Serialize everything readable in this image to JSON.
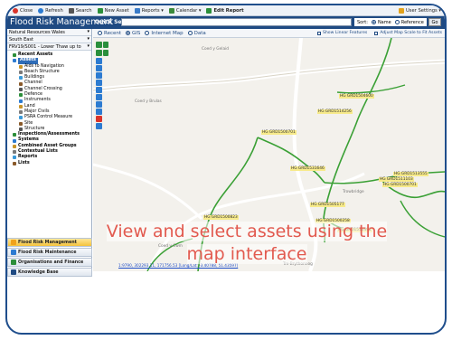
{
  "toolbar": {
    "items": [
      {
        "label": "Close",
        "icon": "close-icon",
        "color": "#d9342b"
      },
      {
        "label": "Refresh",
        "icon": "refresh-icon",
        "color": "#2c7bd1"
      },
      {
        "label": "Search",
        "icon": "binoculars-icon",
        "color": "#555555"
      },
      {
        "label": "New Asset",
        "icon": "new-asset-icon",
        "color": "#2c8f3a"
      },
      {
        "label": "Reports",
        "icon": "reports-icon",
        "color": "#3a7bc8"
      },
      {
        "label": "Calendar",
        "icon": "calendar-icon",
        "color": "#3b8a3b"
      },
      {
        "label": "Edit Report",
        "icon": "edit-report-icon",
        "color": "#2c8f3a"
      }
    ],
    "user_settings": "User Settings"
  },
  "header": {
    "title": "Flood Risk Management",
    "quick_search_label": "Quick Search:",
    "search_value": "",
    "sort_label": "Sort:",
    "sort_options": [
      "Name",
      "Reference"
    ],
    "go_label": "Go",
    "bg_color": "#1f4a82"
  },
  "sidebar": {
    "org": "Natural Resources Wales",
    "region": "South East",
    "system": "FRV19/S001 - Lower Thaw up to",
    "tree": [
      {
        "label": "Recent Assets",
        "bold": true,
        "icon": "recent-assets-icon",
        "indent": 1
      },
      {
        "label": "Assets",
        "bold": true,
        "selected": true,
        "icon": "assets-icon",
        "indent": 1
      },
      {
        "label": "Aids to Navigation",
        "icon": "navigation-icon",
        "indent": 2
      },
      {
        "label": "Beach Structure",
        "icon": "beach-icon",
        "indent": 2
      },
      {
        "label": "Buildings",
        "icon": "building-icon",
        "indent": 2
      },
      {
        "label": "Channel",
        "icon": "channel-icon",
        "indent": 2
      },
      {
        "label": "Channel Crossing",
        "icon": "crossing-icon",
        "indent": 2
      },
      {
        "label": "Defence",
        "icon": "defence-icon",
        "indent": 2
      },
      {
        "label": "Instruments",
        "icon": "instrument-icon",
        "indent": 2
      },
      {
        "label": "Land",
        "icon": "land-icon",
        "indent": 2
      },
      {
        "label": "Major Civils",
        "icon": "civils-icon",
        "indent": 2
      },
      {
        "label": "PSRA Control Measure",
        "icon": "control-icon",
        "indent": 2
      },
      {
        "label": "Site",
        "icon": "site-icon",
        "indent": 2
      },
      {
        "label": "Structure",
        "icon": "structure-icon",
        "indent": 2
      },
      {
        "label": "Inspections/Assessments",
        "bold": true,
        "icon": "inspection-icon",
        "indent": 1
      },
      {
        "label": "Systems",
        "bold": true,
        "icon": "systems-icon",
        "indent": 1
      },
      {
        "label": "Combined Asset Groups",
        "bold": true,
        "icon": "groups-icon",
        "indent": 1
      },
      {
        "label": "Contextual Lists",
        "bold": true,
        "icon": "lists-icon",
        "indent": 1
      },
      {
        "label": "Reports",
        "bold": true,
        "icon": "reports-icon",
        "indent": 1
      },
      {
        "label": "Lists",
        "bold": true,
        "icon": "lists-icon",
        "indent": 1
      }
    ],
    "nav_buttons": [
      {
        "label": "Flood Risk Management",
        "active": true,
        "color": "#f0a21c"
      },
      {
        "label": "Flood Risk Maintenance",
        "active": false,
        "color": "#2c7bd1"
      },
      {
        "label": "Organisations and Finance",
        "active": false,
        "color": "#2c8f3a"
      },
      {
        "label": "Knowledge Base",
        "active": false,
        "color": "#1f4a82"
      }
    ]
  },
  "map": {
    "views": [
      "Recent",
      "GIS",
      "Internet Map",
      "Data"
    ],
    "selected_view": "GIS",
    "options": [
      "Show Linear Features",
      "Adjust Map Scale to Fit Assets"
    ],
    "places": [
      "Coed y Gelaid",
      "Coed y Brulas",
      "Trowbridge",
      "Coed y Cwm",
      "Tre-Brythonnog"
    ],
    "assets": [
      "HG GRD1504600",
      "HG GRD1514256",
      "HG GRD1500701",
      "HG GRD1531646",
      "HG GRD1505177",
      "HG GRD1513555",
      "HG GRD1500701",
      "HG GRD1511103",
      "HG GRD1500823",
      "HG GRD1500258",
      "HG GRD1512491"
    ],
    "coords": "1:9790, 302293.11, 171756.53 [Long/Lat: -3.40788, 51.43597]",
    "line_color": "#3aa035"
  },
  "caption": {
    "line1": "View and select assets using the",
    "line2": "map interface",
    "color": "#e25a4f"
  }
}
